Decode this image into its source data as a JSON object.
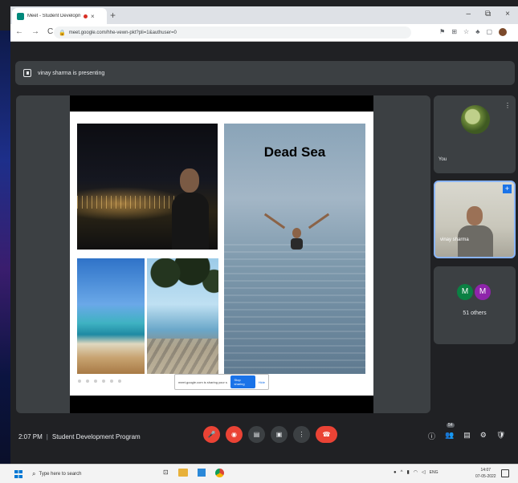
{
  "browser": {
    "tab_title": "Meet - Student Development Program",
    "new_tab": "+",
    "tab_close": "×",
    "nav": {
      "back": "←",
      "forward": "→",
      "reload": "C"
    },
    "url": "meet.google.com/hhe-vewn-pkt?pli=1&authuser=0",
    "window": {
      "minimize": "–",
      "restore": "⧉",
      "close": "×"
    },
    "ext_icons": [
      "⚑",
      "⊞",
      "☆",
      "♣",
      "▢"
    ]
  },
  "meet": {
    "presenting_banner": "vinay sharma is presenting",
    "slide": {
      "title": "Dead Sea"
    },
    "share_bar": {
      "message": "meet.google.com is sharing your screen",
      "stop_label": "Stop sharing",
      "hide_label": "Hide"
    },
    "tiles": {
      "you": {
        "name": "You",
        "more": "⋮"
      },
      "presenter": {
        "name": "vinay sharma",
        "pin": "+"
      },
      "others": {
        "avatar1": "M",
        "avatar2": "M",
        "count_label": "51 others"
      }
    },
    "footer": {
      "time": "2:07 PM",
      "separator": "|",
      "meeting_name": "Student Development Program",
      "participants_badge": "54"
    },
    "controls": {
      "mic": "🎤",
      "camera": "◉",
      "captions": "▤",
      "present": "▣",
      "more": "⋮",
      "hangup": "☎"
    },
    "right_controls": {
      "info": "ⓘ",
      "people": "👥",
      "chat": "▤",
      "activities": "⚙",
      "host": "🛡"
    }
  },
  "taskbar": {
    "search_placeholder": "Type here to search",
    "search_icon": "⌕",
    "task_view": "⊡",
    "tray_lang": "ENG",
    "time": "14:07",
    "date": "07-05-2022"
  },
  "colors": {
    "meet_bg": "#202124",
    "tile_bg": "#3c4043",
    "accent_red": "#ea4335",
    "accent_blue": "#1a73e8"
  }
}
